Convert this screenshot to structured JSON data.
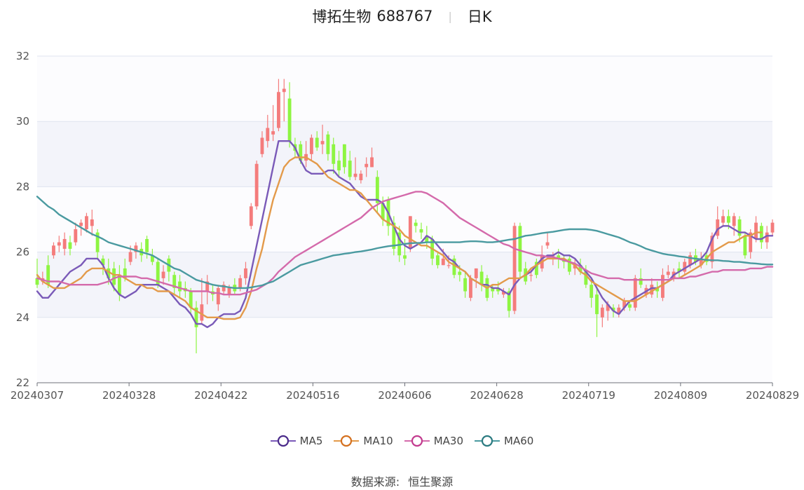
{
  "header": {
    "stock_name": "博拓生物",
    "stock_code": "688767",
    "period": "日K"
  },
  "footer": {
    "source_label": "数据来源:",
    "source_name": "恒生聚源"
  },
  "colors": {
    "up": "#f47c7c",
    "down": "#8ef542",
    "MA5": "#7a5ab8",
    "MA10": "#e39a4a",
    "MA30": "#d46aab",
    "MA60": "#4a9aa0",
    "grid": "#dfe3f0",
    "band": "#f3f4fa"
  },
  "chart_data": {
    "type": "candlestick",
    "ylim": [
      22,
      32
    ],
    "y_ticks": [
      22,
      24,
      26,
      28,
      30,
      32
    ],
    "x_tick_labels": [
      "20240307",
      "20240328",
      "20240422",
      "20240516",
      "20240606",
      "20240628",
      "20240719",
      "20240809",
      "20240829"
    ],
    "legend": [
      "MA5",
      "MA10",
      "MA30",
      "MA60"
    ],
    "candles": [
      [
        25.2,
        25.0,
        25.8,
        24.9
      ],
      [
        25.1,
        25.2,
        25.4,
        25.0
      ],
      [
        25.6,
        25.0,
        25.9,
        24.9
      ],
      [
        25.9,
        26.2,
        26.3,
        25.8
      ],
      [
        26.2,
        26.3,
        26.5,
        26.0
      ],
      [
        26.1,
        26.4,
        26.6,
        25.9
      ],
      [
        26.3,
        26.1,
        26.5,
        25.9
      ],
      [
        26.3,
        26.7,
        26.9,
        26.2
      ],
      [
        26.8,
        26.9,
        27.0,
        26.5
      ],
      [
        26.7,
        27.1,
        27.2,
        26.6
      ],
      [
        26.8,
        27.0,
        27.3,
        26.5
      ],
      [
        26.6,
        26.0,
        26.7,
        25.8
      ],
      [
        25.8,
        25.6,
        25.9,
        25.3
      ],
      [
        25.5,
        25.2,
        25.8,
        25.0
      ],
      [
        25.5,
        25.0,
        25.7,
        24.8
      ],
      [
        25.3,
        24.7,
        25.6,
        24.5
      ],
      [
        25.5,
        25.2,
        25.8,
        25.1
      ],
      [
        25.7,
        26.0,
        26.2,
        25.6
      ],
      [
        26.0,
        26.2,
        26.3,
        25.8
      ],
      [
        26.1,
        25.9,
        26.3,
        25.7
      ],
      [
        26.4,
        26.0,
        26.5,
        25.8
      ],
      [
        25.9,
        25.7,
        26.1,
        25.6
      ],
      [
        25.7,
        25.0,
        25.8,
        24.9
      ],
      [
        25.2,
        25.4,
        25.6,
        25.0
      ],
      [
        25.8,
        25.4,
        25.9,
        25.1
      ],
      [
        25.3,
        24.9,
        25.4,
        24.7
      ],
      [
        25.1,
        24.8,
        25.3,
        24.6
      ],
      [
        24.9,
        24.8,
        25.1,
        24.6
      ],
      [
        24.8,
        24.3,
        24.9,
        24.1
      ],
      [
        24.3,
        23.7,
        24.5,
        22.9
      ],
      [
        23.9,
        24.4,
        25.2,
        23.8
      ],
      [
        24.8,
        25.1,
        25.3,
        24.4
      ],
      [
        24.8,
        24.7,
        25.0,
        24.5
      ],
      [
        24.4,
        24.9,
        25.0,
        24.2
      ],
      [
        24.8,
        25.0,
        25.1,
        24.7
      ],
      [
        24.7,
        24.9,
        25.0,
        24.6
      ],
      [
        25.0,
        24.8,
        25.2,
        24.7
      ],
      [
        24.9,
        25.2,
        25.3,
        24.8
      ],
      [
        25.2,
        25.5,
        25.7,
        25.0
      ],
      [
        26.8,
        27.4,
        27.5,
        26.7
      ],
      [
        27.4,
        28.7,
        28.8,
        27.3
      ],
      [
        29.0,
        29.5,
        29.7,
        28.9
      ],
      [
        29.4,
        29.8,
        30.2,
        29.2
      ],
      [
        29.6,
        29.7,
        30.5,
        29.4
      ],
      [
        29.8,
        30.9,
        31.3,
        29.7
      ],
      [
        30.9,
        31.0,
        31.3,
        30.0
      ],
      [
        30.7,
        29.4,
        31.2,
        29.2
      ],
      [
        29.3,
        29.1,
        29.5,
        28.9
      ],
      [
        29.3,
        28.8,
        29.4,
        28.7
      ],
      [
        28.8,
        29.0,
        29.4,
        28.6
      ],
      [
        29.0,
        29.5,
        29.6,
        28.8
      ],
      [
        29.5,
        29.2,
        29.7,
        29.1
      ],
      [
        29.3,
        29.4,
        29.9,
        29.0
      ],
      [
        29.6,
        29.0,
        29.7,
        28.8
      ],
      [
        29.3,
        28.7,
        29.5,
        28.4
      ],
      [
        28.8,
        28.5,
        29.1,
        28.3
      ],
      [
        29.3,
        28.6,
        29.3,
        28.4
      ],
      [
        28.8,
        28.3,
        29.1,
        28.2
      ],
      [
        28.3,
        28.4,
        28.9,
        28.2
      ],
      [
        28.2,
        28.4,
        28.5,
        28.1
      ],
      [
        28.6,
        28.7,
        28.9,
        28.3
      ],
      [
        28.6,
        28.9,
        29.2,
        28.6
      ],
      [
        28.3,
        27.5,
        28.5,
        27.2
      ],
      [
        27.5,
        27.0,
        27.7,
        26.8
      ],
      [
        27.6,
        26.8,
        27.7,
        26.5
      ],
      [
        26.9,
        26.1,
        27.1,
        25.9
      ],
      [
        26.6,
        25.9,
        26.8,
        25.7
      ],
      [
        25.9,
        25.8,
        26.4,
        25.6
      ],
      [
        26.1,
        27.1,
        27.1,
        26.0
      ],
      [
        26.9,
        26.8,
        27.0,
        26.6
      ],
      [
        26.7,
        26.6,
        26.9,
        26.4
      ],
      [
        26.5,
        26.3,
        26.8,
        26.1
      ],
      [
        26.4,
        25.8,
        26.5,
        25.6
      ],
      [
        25.9,
        25.6,
        26.0,
        25.5
      ],
      [
        25.6,
        25.8,
        26.1,
        25.6
      ],
      [
        25.6,
        25.6,
        25.9,
        25.5
      ],
      [
        25.8,
        25.3,
        25.9,
        25.2
      ],
      [
        25.4,
        25.3,
        25.6,
        25.1
      ],
      [
        25.2,
        24.8,
        25.4,
        24.6
      ],
      [
        24.6,
        25.2,
        25.3,
        24.5
      ],
      [
        25.2,
        25.5,
        25.5,
        24.9
      ],
      [
        25.4,
        25.0,
        25.6,
        24.8
      ],
      [
        25.2,
        24.6,
        25.3,
        24.5
      ],
      [
        24.9,
        24.8,
        25.0,
        24.6
      ],
      [
        24.9,
        24.8,
        25.1,
        24.7
      ],
      [
        24.7,
        24.8,
        24.9,
        24.6
      ],
      [
        24.8,
        24.2,
        24.9,
        24.0
      ],
      [
        24.2,
        26.8,
        26.9,
        24.1
      ],
      [
        26.8,
        25.4,
        26.9,
        25.2
      ],
      [
        25.5,
        25.1,
        25.7,
        25.0
      ],
      [
        25.3,
        25.3,
        25.5,
        25.1
      ],
      [
        25.7,
        25.3,
        25.8,
        25.2
      ],
      [
        25.5,
        25.9,
        26.2,
        25.4
      ],
      [
        26.2,
        26.3,
        26.6,
        26.1
      ],
      [
        25.9,
        25.9,
        26.0,
        25.6
      ],
      [
        25.9,
        25.8,
        26.1,
        25.5
      ],
      [
        25.8,
        25.7,
        25.9,
        25.5
      ],
      [
        25.8,
        25.4,
        25.9,
        25.3
      ],
      [
        25.5,
        25.6,
        25.8,
        25.3
      ],
      [
        25.6,
        25.4,
        25.8,
        25.3
      ],
      [
        25.4,
        25.0,
        25.6,
        24.9
      ],
      [
        25.0,
        24.6,
        25.2,
        24.3
      ],
      [
        24.7,
        24.1,
        24.9,
        23.4
      ],
      [
        24.0,
        24.3,
        24.4,
        23.7
      ],
      [
        24.2,
        24.4,
        24.5,
        23.9
      ],
      [
        24.3,
        24.2,
        24.4,
        24.0
      ],
      [
        24.1,
        24.3,
        24.4,
        24.0
      ],
      [
        24.3,
        24.5,
        24.6,
        24.2
      ],
      [
        24.4,
        24.3,
        24.5,
        24.2
      ],
      [
        24.3,
        25.2,
        25.3,
        24.2
      ],
      [
        25.2,
        25.0,
        25.5,
        24.9
      ],
      [
        24.7,
        24.9,
        25.0,
        24.6
      ],
      [
        24.7,
        25.0,
        25.2,
        24.6
      ],
      [
        24.9,
        24.8,
        25.1,
        24.6
      ],
      [
        24.6,
        25.3,
        25.5,
        24.5
      ],
      [
        25.3,
        25.4,
        25.6,
        25.2
      ],
      [
        25.2,
        25.4,
        25.5,
        25.1
      ],
      [
        25.5,
        25.4,
        25.7,
        25.2
      ],
      [
        25.4,
        25.7,
        25.8,
        25.3
      ],
      [
        25.6,
        25.9,
        26.0,
        25.5
      ],
      [
        25.9,
        25.7,
        26.1,
        25.6
      ],
      [
        25.6,
        25.8,
        26.0,
        25.5
      ],
      [
        25.9,
        25.7,
        26.0,
        25.6
      ],
      [
        25.7,
        26.5,
        26.6,
        25.5
      ],
      [
        26.5,
        27.0,
        27.4,
        26.4
      ],
      [
        26.9,
        27.1,
        27.3,
        26.8
      ],
      [
        27.1,
        26.9,
        27.3,
        26.7
      ],
      [
        26.8,
        27.1,
        27.2,
        26.5
      ],
      [
        27.0,
        26.5,
        27.1,
        26.3
      ],
      [
        26.5,
        25.9,
        26.6,
        25.8
      ],
      [
        26.0,
        26.6,
        26.7,
        25.8
      ],
      [
        26.4,
        26.9,
        27.1,
        26.3
      ],
      [
        26.8,
        26.3,
        26.9,
        26.1
      ],
      [
        26.3,
        26.6,
        26.8,
        26.1
      ],
      [
        26.6,
        26.9,
        27.0,
        26.5
      ]
    ],
    "series": [
      {
        "name": "MA5",
        "values": [
          24.8,
          24.6,
          24.6,
          24.8,
          25.0,
          25.2,
          25.4,
          25.5,
          25.6,
          25.8,
          25.8,
          25.8,
          25.6,
          25.2,
          24.9,
          24.7,
          24.6,
          24.7,
          24.8,
          25.0,
          25.0,
          25.0,
          25.0,
          24.9,
          24.8,
          24.6,
          24.4,
          24.3,
          24.1,
          23.8,
          23.8,
          23.7,
          23.8,
          24.0,
          24.1,
          24.1,
          24.1,
          24.2,
          24.6,
          25.4,
          26.2,
          27.0,
          27.8,
          28.6,
          29.4,
          29.4,
          29.4,
          29.2,
          28.8,
          28.5,
          28.4,
          28.4,
          28.4,
          28.5,
          28.5,
          28.3,
          28.2,
          28.1,
          27.9,
          27.7,
          27.6,
          27.6,
          27.6,
          27.5,
          27.2,
          26.8,
          26.4,
          26.2,
          26.1,
          26.2,
          26.3,
          26.5,
          26.4,
          26.2,
          26.0,
          25.8,
          25.7,
          25.5,
          25.4,
          25.2,
          25.1,
          25.0,
          25.0,
          24.9,
          24.9,
          24.8,
          24.7,
          25.0,
          25.2,
          25.3,
          25.4,
          25.6,
          25.8,
          25.9,
          25.9,
          26.0,
          25.9,
          25.9,
          25.8,
          25.6,
          25.4,
          25.2,
          24.9,
          24.6,
          24.4,
          24.2,
          24.1,
          24.3,
          24.5,
          24.6,
          24.7,
          24.8,
          24.9,
          24.9,
          25.0,
          25.1,
          25.3,
          25.4,
          25.5,
          25.6,
          25.7,
          25.8,
          26.0,
          26.4,
          26.7,
          26.8,
          26.8,
          26.7,
          26.6,
          26.6,
          26.5,
          26.4,
          26.4,
          26.5,
          26.5
        ]
      },
      {
        "name": "MA10",
        "values": [
          25.3,
          25.1,
          25.0,
          24.9,
          24.9,
          24.9,
          25.0,
          25.1,
          25.2,
          25.4,
          25.5,
          25.5,
          25.5,
          25.4,
          25.3,
          25.3,
          25.2,
          25.1,
          25.0,
          25.0,
          24.9,
          24.9,
          24.8,
          24.8,
          24.8,
          24.7,
          24.6,
          24.5,
          24.3,
          24.2,
          24.1,
          24.0,
          24.0,
          24.0,
          23.95,
          23.95,
          23.95,
          24.0,
          24.3,
          24.8,
          25.5,
          26.1,
          26.9,
          27.6,
          28.1,
          28.6,
          28.8,
          28.9,
          28.9,
          28.9,
          28.8,
          28.7,
          28.5,
          28.3,
          28.2,
          28.1,
          28.0,
          27.9,
          27.9,
          27.8,
          27.6,
          27.4,
          27.2,
          27.0,
          26.9,
          26.8,
          26.7,
          26.5,
          26.4,
          26.3,
          26.2,
          26.2,
          26.1,
          26.0,
          25.9,
          25.7,
          25.6,
          25.5,
          25.4,
          25.2,
          25.1,
          25.0,
          24.9,
          25.0,
          25.0,
          25.1,
          25.2,
          25.2,
          25.2,
          25.3,
          25.5,
          25.6,
          25.7,
          25.8,
          25.8,
          25.8,
          25.8,
          25.7,
          25.6,
          25.4,
          25.3,
          25.1,
          25.0,
          24.9,
          24.8,
          24.7,
          24.6,
          24.5,
          24.5,
          24.5,
          24.6,
          24.7,
          24.8,
          24.9,
          25.0,
          25.1,
          25.2,
          25.2,
          25.3,
          25.4,
          25.5,
          25.6,
          25.8,
          26.0,
          26.1,
          26.2,
          26.3,
          26.3,
          26.4,
          26.5,
          26.5,
          26.6,
          26.6
        ]
      },
      {
        "name": "MA30",
        "values": [
          25.2,
          25.15,
          25.1,
          25.1,
          25.1,
          25.05,
          25.0,
          25.0,
          25.0,
          25.0,
          25.0,
          25.0,
          25.05,
          25.1,
          25.2,
          25.25,
          25.25,
          25.25,
          25.25,
          25.2,
          25.2,
          25.15,
          25.1,
          25.05,
          25.0,
          24.95,
          24.9,
          24.85,
          24.8,
          24.8,
          24.8,
          24.8,
          24.75,
          24.75,
          24.7,
          24.7,
          24.7,
          24.7,
          24.75,
          24.8,
          24.85,
          24.95,
          25.05,
          25.2,
          25.4,
          25.55,
          25.7,
          25.85,
          25.95,
          26.05,
          26.15,
          26.25,
          26.35,
          26.45,
          26.55,
          26.65,
          26.75,
          26.85,
          26.95,
          27.05,
          27.2,
          27.35,
          27.45,
          27.55,
          27.6,
          27.65,
          27.7,
          27.75,
          27.8,
          27.85,
          27.85,
          27.8,
          27.7,
          27.6,
          27.5,
          27.35,
          27.2,
          27.05,
          26.95,
          26.85,
          26.75,
          26.65,
          26.55,
          26.45,
          26.35,
          26.25,
          26.2,
          26.1,
          26.05,
          26.0,
          25.95,
          25.9,
          25.9,
          25.85,
          25.85,
          25.8,
          25.75,
          25.7,
          25.65,
          25.55,
          25.45,
          25.35,
          25.3,
          25.25,
          25.2,
          25.2,
          25.2,
          25.15,
          25.15,
          25.15,
          25.15,
          25.15,
          25.15,
          25.15,
          25.15,
          25.15,
          25.2,
          25.2,
          25.2,
          25.25,
          25.25,
          25.3,
          25.35,
          25.4,
          25.4,
          25.45,
          25.45,
          25.45,
          25.45,
          25.45,
          25.5,
          25.5,
          25.5,
          25.55,
          25.55
        ]
      },
      {
        "name": "MA60",
        "values": [
          27.7,
          27.55,
          27.4,
          27.3,
          27.15,
          27.05,
          26.95,
          26.85,
          26.75,
          26.65,
          26.55,
          26.48,
          26.4,
          26.3,
          26.25,
          26.2,
          26.15,
          26.1,
          26.05,
          26.0,
          25.95,
          25.9,
          25.8,
          25.7,
          25.6,
          25.5,
          25.45,
          25.35,
          25.25,
          25.15,
          25.1,
          25.05,
          25.0,
          24.97,
          24.95,
          24.92,
          24.9,
          24.9,
          24.9,
          24.92,
          24.95,
          24.98,
          25.05,
          25.1,
          25.2,
          25.3,
          25.4,
          25.5,
          25.6,
          25.65,
          25.7,
          25.75,
          25.8,
          25.85,
          25.9,
          25.92,
          25.95,
          25.97,
          26.0,
          26.02,
          26.05,
          26.08,
          26.12,
          26.15,
          26.18,
          26.2,
          26.22,
          26.25,
          26.27,
          26.28,
          26.28,
          26.3,
          26.3,
          26.3,
          26.3,
          26.3,
          26.3,
          26.3,
          26.32,
          26.33,
          26.33,
          26.32,
          26.3,
          26.3,
          26.32,
          26.35,
          26.38,
          26.4,
          26.45,
          26.5,
          26.52,
          26.55,
          26.58,
          26.6,
          26.62,
          26.65,
          26.68,
          26.7,
          26.7,
          26.7,
          26.7,
          26.68,
          26.65,
          26.6,
          26.55,
          26.5,
          26.45,
          26.38,
          26.3,
          26.25,
          26.18,
          26.1,
          26.05,
          26.0,
          25.95,
          25.92,
          25.9,
          25.87,
          25.85,
          25.82,
          25.8,
          25.78,
          25.76,
          25.75,
          25.75,
          25.73,
          25.72,
          25.7,
          25.7,
          25.68,
          25.66,
          25.65,
          25.63,
          25.62,
          25.62
        ]
      }
    ]
  }
}
